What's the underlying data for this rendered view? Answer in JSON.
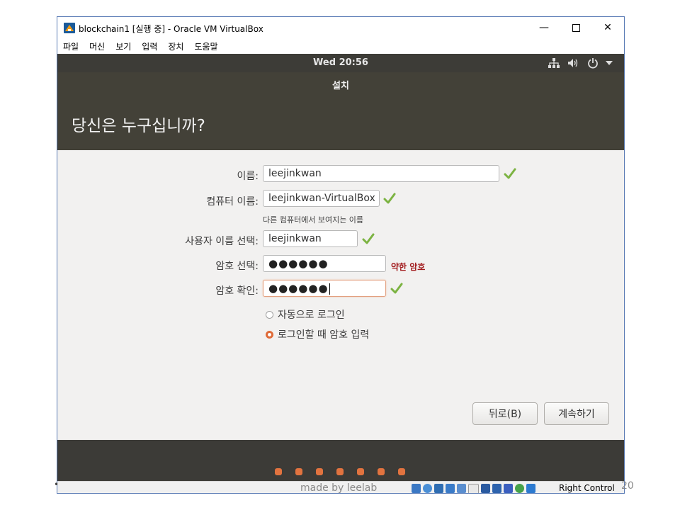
{
  "window": {
    "title": "blockchain1 [실행 중] - Oracle VM VirtualBox"
  },
  "menubar": {
    "items": [
      "파일",
      "머신",
      "보기",
      "입력",
      "장치",
      "도움말"
    ]
  },
  "ubuntu_topbar": {
    "clock": "Wed 20:56",
    "indicators": [
      "network-icon",
      "volume-icon",
      "power-icon",
      "dropdown-icon"
    ]
  },
  "installer": {
    "header_title": "설치",
    "heading": "당신은 누구십니까?",
    "form": {
      "name_label": "이름:",
      "name_value": "leejinkwan",
      "computer_label": "컴퓨터 이름:",
      "computer_value": "leejinkwan-VirtualBox",
      "computer_hint": "다른 컴퓨터에서 보여지는 이름",
      "username_label": "사용자 이름 선택:",
      "username_value": "leejinkwan",
      "password_label": "암호 선택:",
      "password_value": "●●●●●●",
      "password_strength": "약한 암호",
      "confirm_label": "암호 확인:",
      "confirm_value": "●●●●●●",
      "login_options": [
        {
          "label": "자동으로 로그인",
          "selected": false
        },
        {
          "label": "로그인할 때 암호 입력",
          "selected": true
        }
      ]
    },
    "buttons": {
      "back": "뒤로(B)",
      "continue": "계속하기"
    },
    "progress": {
      "total": 7,
      "accent": "#e2733f"
    }
  },
  "statusbar": {
    "made_by": "made by leelab",
    "host_key": "Right Control"
  },
  "slide": {
    "page": "20",
    "bullet": "•"
  },
  "colors": {
    "header": "#434138",
    "content_bg": "#f2f1f0",
    "accent_orange": "#df6a37",
    "weak_red": "#a1191b",
    "check_green": "#7cb342"
  }
}
